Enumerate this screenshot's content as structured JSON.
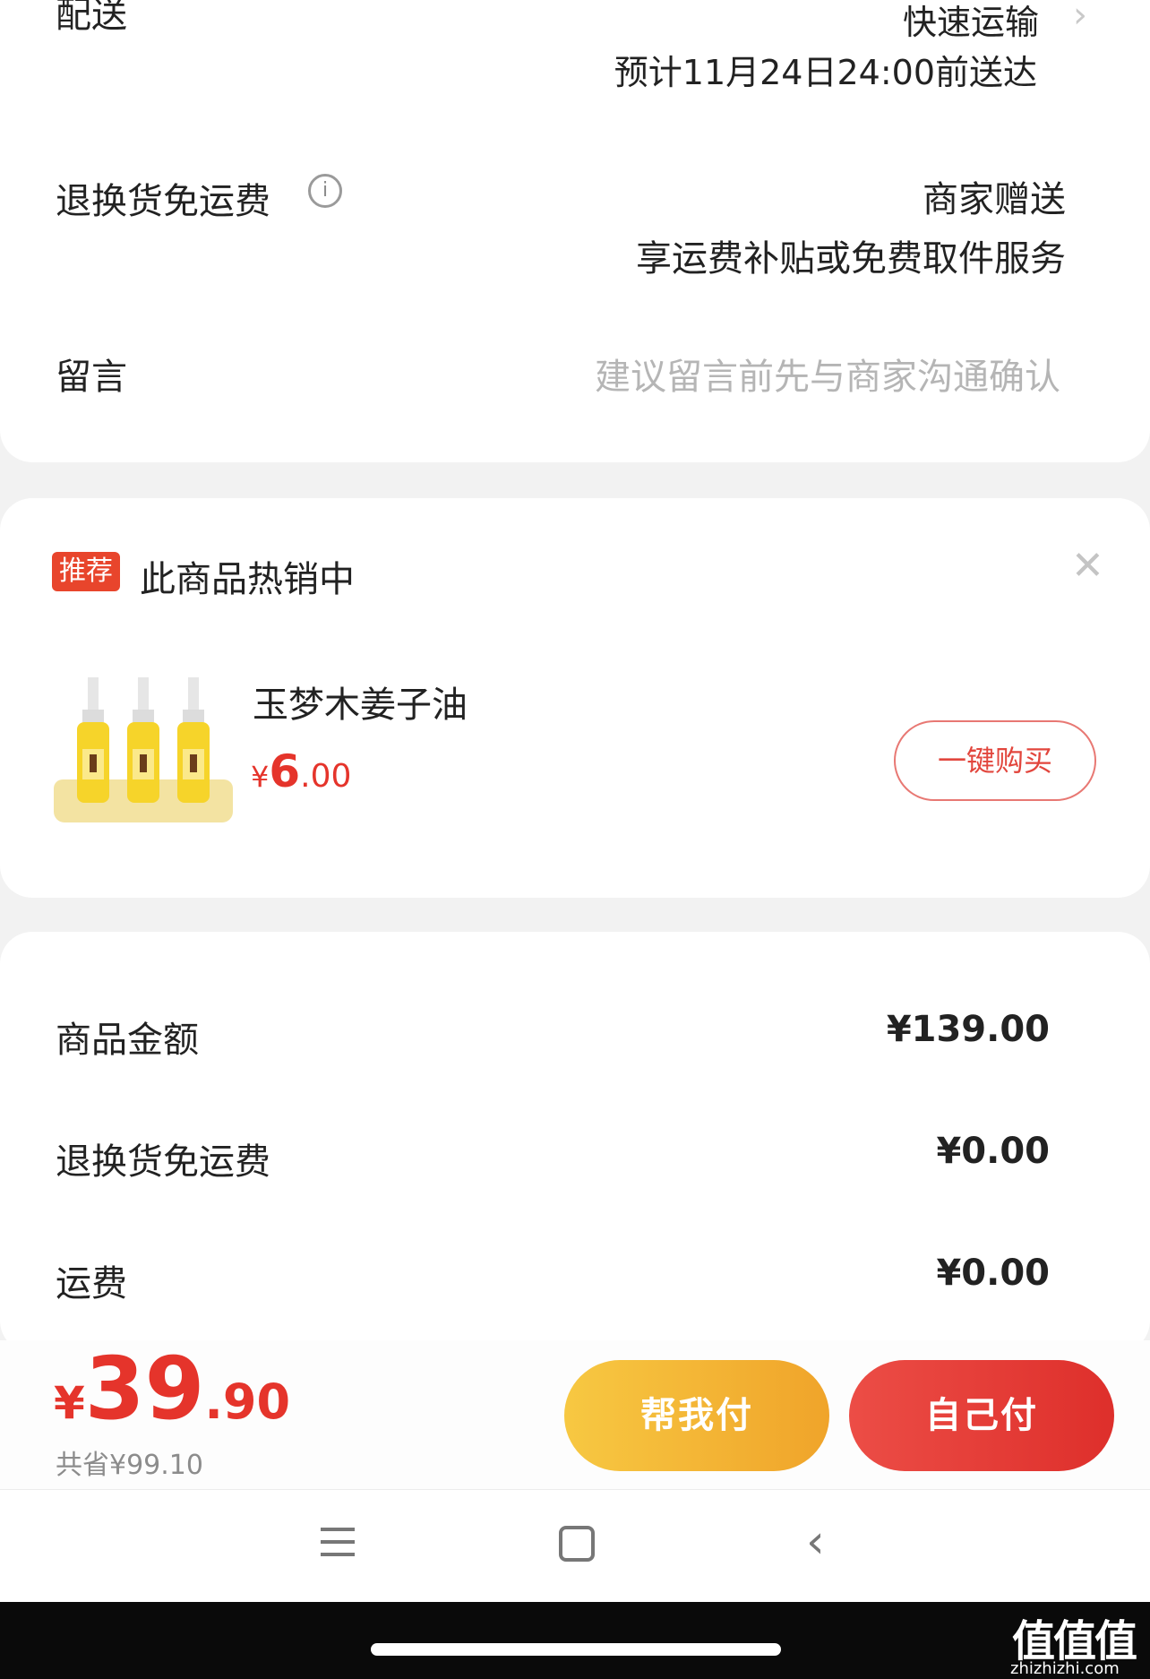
{
  "delivery": {
    "label": "配送",
    "method": "快速运输",
    "eta": "预计11月24日24:00前送达"
  },
  "return_shipping": {
    "label": "退换货免运费",
    "value": "商家赠送",
    "sub": "享运费补贴或免费取件服务"
  },
  "message": {
    "label": "留言",
    "placeholder": "建议留言前先与商家沟通确认"
  },
  "recommend": {
    "tag": "推荐",
    "title": "此商品热销中",
    "product_name": "玉梦木姜子油",
    "price_symbol": "¥",
    "price_int": "6",
    "price_dec": ".00",
    "buy_label": "一键购买"
  },
  "summary": {
    "rows": [
      {
        "label": "商品金额",
        "value": "¥139.00"
      },
      {
        "label": "退换货免运费",
        "value": "¥0.00"
      },
      {
        "label": "运费",
        "value": "¥0.00"
      }
    ]
  },
  "pay": {
    "symbol": "¥",
    "total_int": "39",
    "total_dec": ".90",
    "saved": "共省¥99.10",
    "help_pay": "帮我付",
    "self_pay": "自己付"
  },
  "watermark": {
    "text": "值值值",
    "url": "zhizhizhi.com"
  },
  "colors": {
    "accent_red": "#e5342b",
    "help_pay_gradient": [
      "#f6c63d",
      "#f1a62b"
    ],
    "self_pay_gradient": [
      "#e94a44",
      "#e0302c"
    ]
  }
}
